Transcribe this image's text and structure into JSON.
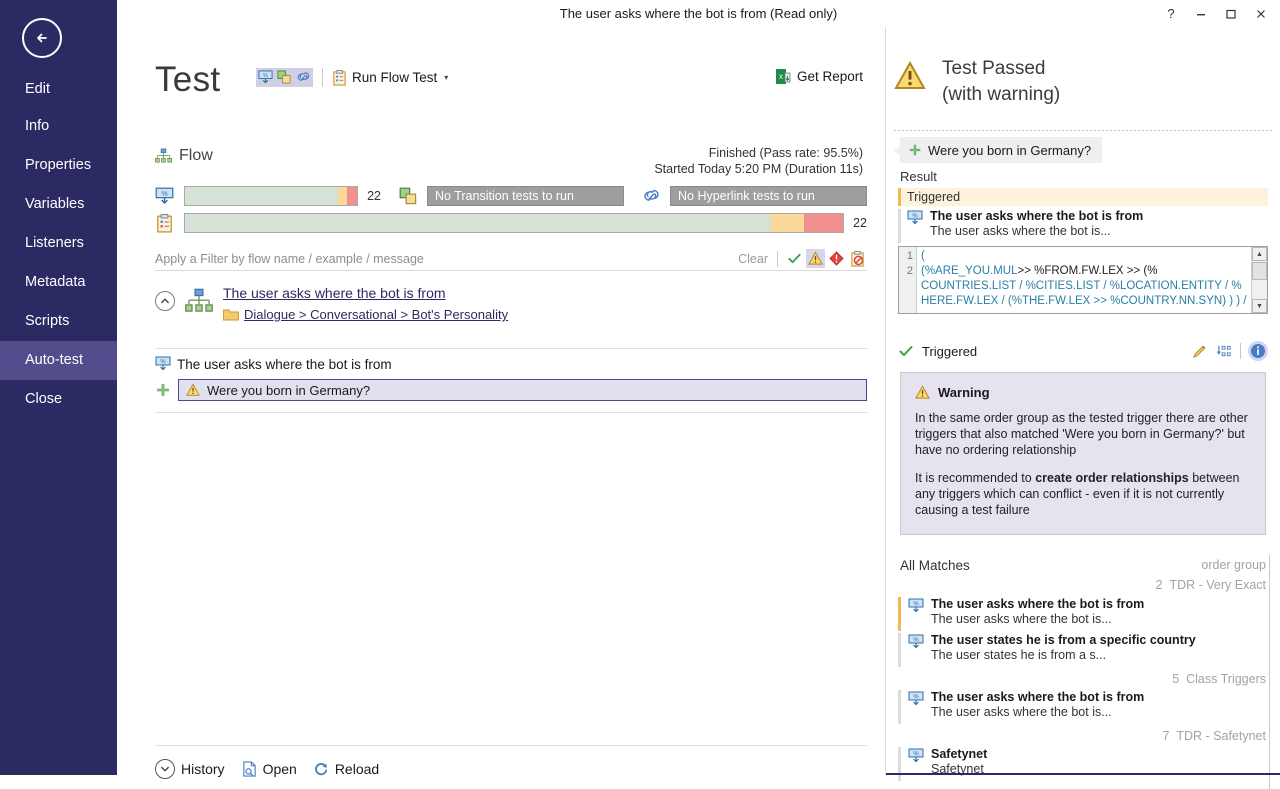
{
  "window": {
    "title": "The user asks where the bot is from (Read only)",
    "help_label": "?",
    "minimize_label": "minimize",
    "maximize_label": "maximize",
    "close_label": "close"
  },
  "sidebar": {
    "back_label": "back",
    "items": [
      {
        "label": "Edit",
        "selected": false
      },
      {
        "label": "Info",
        "selected": false
      },
      {
        "label": "Properties",
        "selected": false
      },
      {
        "label": "Variables",
        "selected": false
      },
      {
        "label": "Listeners",
        "selected": false
      },
      {
        "label": "Metadata",
        "selected": false
      },
      {
        "label": "Scripts",
        "selected": false
      },
      {
        "label": "Auto-test",
        "selected": true
      },
      {
        "label": "Close",
        "selected": false
      }
    ]
  },
  "main": {
    "page_title": "Test",
    "run_flow_test": "Run Flow Test",
    "run_flow_caret": "▾",
    "get_report": "Get Report",
    "flow_label": "Flow",
    "status_line_1": "Finished (Pass rate: 95.5%)",
    "status_line_2": "Started Today 5:20 PM (Duration 11s)",
    "progress": {
      "flow_count": "22",
      "flow_pass_pct": 89,
      "flow_warn_pct": 5,
      "flow_fail_pct": 6,
      "transition_disabled": "No Transition tests to run",
      "hyperlink_disabled": "No Hyperlink tests to run",
      "example_count": "22",
      "example_pass_pct": 89,
      "example_warn_pct": 5,
      "example_fail_pct": 6
    },
    "filter": {
      "placeholder": "Apply a Filter by flow name / example / message",
      "clear_label": "Clear"
    },
    "flow_card": {
      "name": "The user asks where the bot is from",
      "path": "Dialogue > Conversational > Bot's Personality"
    },
    "test_row_label": "The user asks where the bot is from",
    "example_row_label": "Were you born in Germany?",
    "bottom": {
      "history": "History",
      "open": "Open",
      "reload": "Reload"
    }
  },
  "right_panel": {
    "status_line_1": "Test Passed",
    "status_line_2": "(with warning)",
    "chip_label": "Were you born in Germany?",
    "result_label": "Result",
    "triggered_band": "Triggered",
    "triggered_item": {
      "title": "The user asks where the bot is from",
      "subtitle": "The user asks where the bot is..."
    },
    "code": {
      "line1_no": "1",
      "line2_no": "2",
      "line1": "(",
      "line2_a": "(%ARE_YOU.MUL",
      "line2_b": ">> %FROM.FW.LEX >> (%",
      "line2_c": "COUNTRIES.LIST / %CITIES.LIST / %LOCATION.ENTITY / %",
      "line2_d": "HERE.FW.LEX / (%THE.FW.LEX >> %COUNTRY.NN.SYN) ) ) /"
    },
    "trigger_status": "Triggered",
    "warning": {
      "title": "Warning",
      "paragraph1": "In the same order group as the tested trigger there are other triggers that also matched 'Were you born in Germany?' but have no ordering relationship",
      "paragraph2_pre": "It is recommended to ",
      "paragraph2_bold": "create order relationships",
      "paragraph2_post": " between any triggers which can conflict - even if it is not currently causing a test failure"
    },
    "matches": {
      "header": "All Matches",
      "order_group_label": "order group",
      "groups": [
        {
          "number": "2",
          "name": "TDR - Very Exact",
          "items": [
            {
              "title": "The user asks where the bot is from",
              "subtitle": "The user asks where the bot is...",
              "highlighted": true
            },
            {
              "title": "The user states he is from a specific country",
              "subtitle": "The user states he is from a s...",
              "highlighted": false
            }
          ]
        },
        {
          "number": "5",
          "name": "Class Triggers",
          "items": [
            {
              "title": "The user asks where the bot is from",
              "subtitle": "The user asks where the bot is...",
              "highlighted": false
            }
          ]
        },
        {
          "number": "7",
          "name": "TDR - Safetynet",
          "items": [
            {
              "title": "Safetynet",
              "subtitle": "Safetynet",
              "highlighted": false
            }
          ]
        }
      ]
    }
  },
  "colors": {
    "sidebar_bg": "#2b2a63",
    "sidebar_selected": "#524d8c",
    "pass_green": "#d6e2d6",
    "warn_amber": "#fbd99b",
    "fail_red": "#f2908f",
    "warn_band": "#fdf3dd",
    "warn_box": "#e6e3ef",
    "link": "#2b2a63",
    "code_blue": "#1d7ea8"
  }
}
